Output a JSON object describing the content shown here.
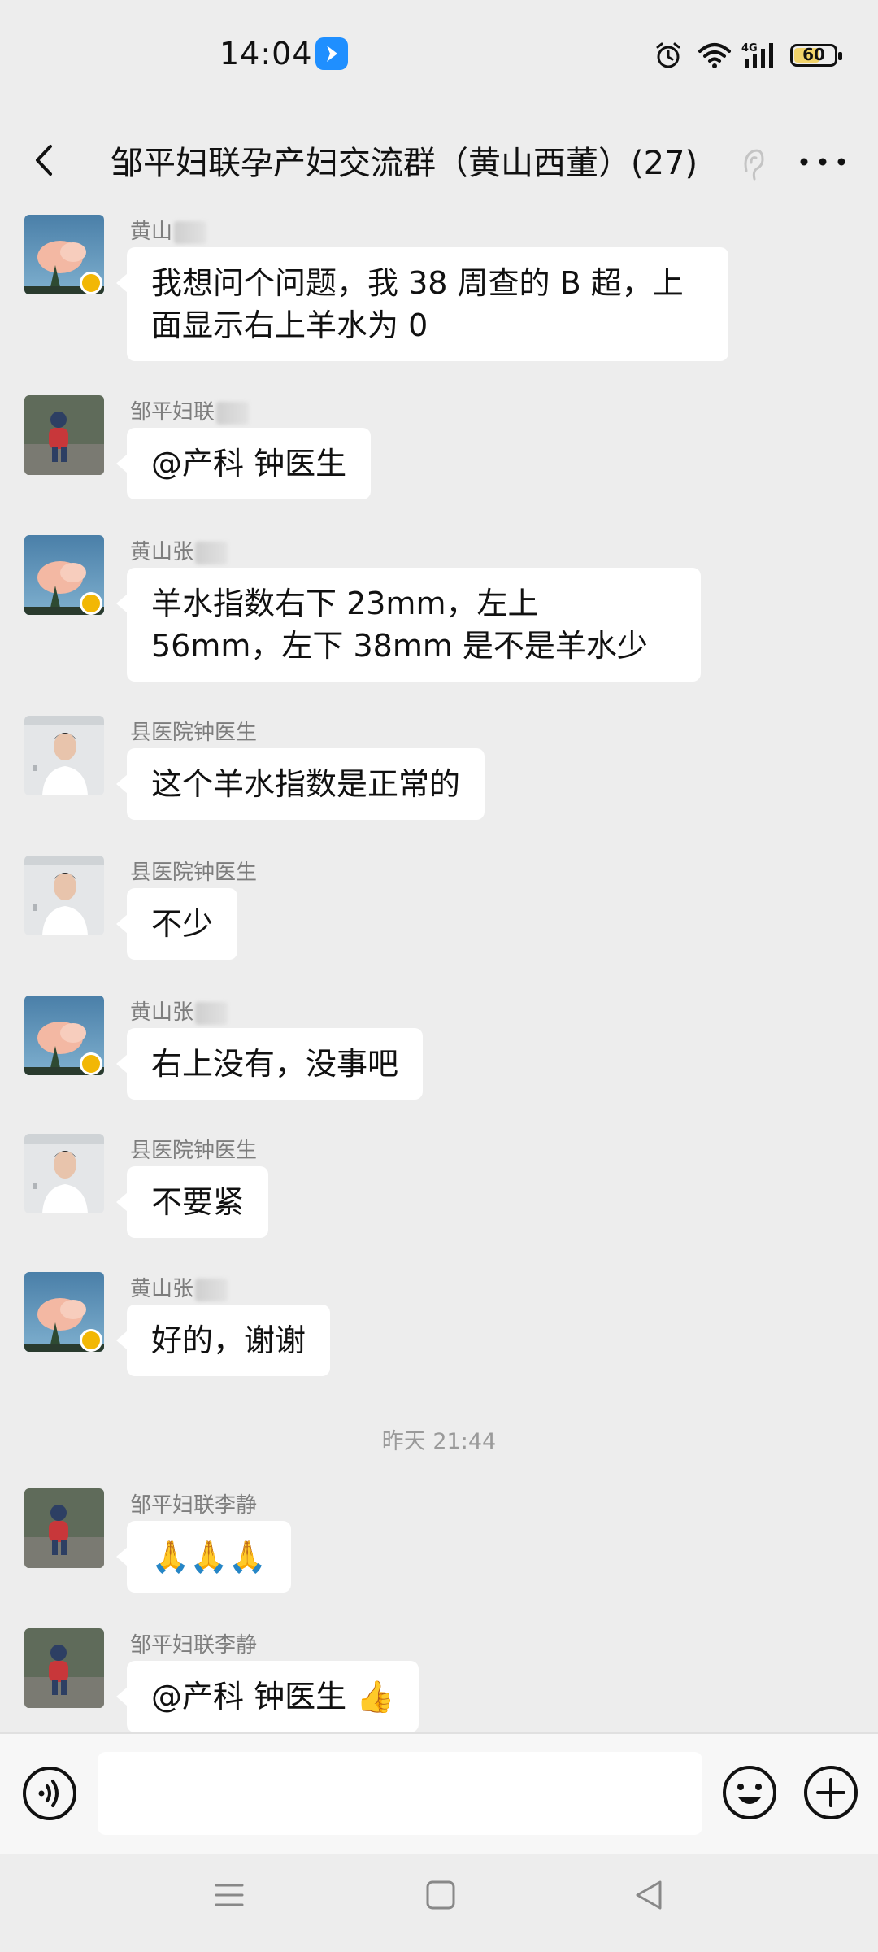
{
  "status_bar": {
    "time": "14:04",
    "battery": "60",
    "battery_level": 0.6,
    "icons": [
      "app-notification-icon",
      "alarm-icon",
      "wifi-icon",
      "4g-signal-icon",
      "battery-icon"
    ]
  },
  "header": {
    "title": "邹平妇联孕产妇交流群（黄山西董）(27)",
    "icons": [
      "back-arrow-icon",
      "ear-icon",
      "more-icon"
    ]
  },
  "messages": [
    {
      "sender": "黄山",
      "avatar": "cloud-avatar",
      "text": "我想问个问题，我 38 周查的 B 超，上面显示右上羊水为 0"
    },
    {
      "sender": "邹平妇联",
      "avatar": "child-avatar",
      "text": "@产科 钟医生"
    },
    {
      "sender": "黄山张",
      "avatar": "cloud-avatar",
      "text": "羊水指数右下 23mm，左上 56mm，左下 38mm 是不是羊水少"
    },
    {
      "sender": "县医院钟医生",
      "avatar": "doctor-avatar",
      "text": "这个羊水指数是正常的"
    },
    {
      "sender": "县医院钟医生",
      "avatar": "doctor-avatar",
      "text": "不少"
    },
    {
      "sender": "黄山张",
      "avatar": "cloud-avatar",
      "text": "右上没有，没事吧"
    },
    {
      "sender": "县医院钟医生",
      "avatar": "doctor-avatar",
      "text": "不要紧"
    },
    {
      "sender": "黄山张",
      "avatar": "cloud-avatar",
      "text": "好的，谢谢"
    },
    {
      "timestamp": "昨天 21:44"
    },
    {
      "sender": "邹平妇联李静",
      "avatar": "child-avatar",
      "text": "🙏🙏🙏"
    },
    {
      "sender": "邹平妇联李静",
      "avatar": "child-avatar",
      "text": "@产科 钟医生 👍"
    }
  ],
  "input_bar": {
    "value": "",
    "icons": [
      "voice-icon",
      "emoji-icon",
      "plus-icon"
    ]
  },
  "nav_bar": {
    "icons": [
      "menu-icon",
      "home-icon",
      "back-icon"
    ]
  }
}
